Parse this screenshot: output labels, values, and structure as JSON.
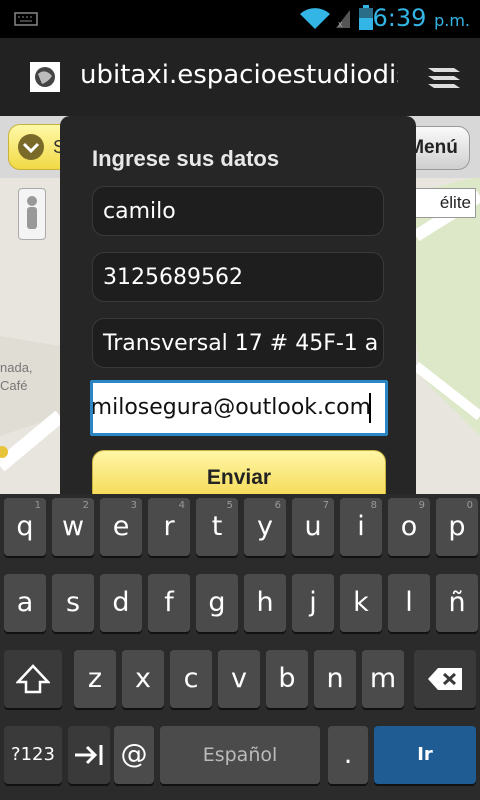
{
  "status_bar": {
    "time": "6:39",
    "ampm": "p.m."
  },
  "browser": {
    "url": "ubitaxi.espacioestudiodise"
  },
  "page": {
    "menu_label": "Menú",
    "map_type_label": "élite",
    "map_text_1": "nada,",
    "map_text_2": "Café",
    "partial_text": "S"
  },
  "dialog": {
    "title": "Ingrese sus datos",
    "name_value": "camilo",
    "phone_value": "3125689562",
    "address_value": "Transversal 17 # 45F-1 a",
    "email_value": "camilosegura@outlook.com",
    "submit_label": "Enviar"
  },
  "keyboard": {
    "row1": [
      {
        "k": "q",
        "h": "1"
      },
      {
        "k": "w",
        "h": "2"
      },
      {
        "k": "e",
        "h": "3"
      },
      {
        "k": "r",
        "h": "4"
      },
      {
        "k": "t",
        "h": "5"
      },
      {
        "k": "y",
        "h": "6"
      },
      {
        "k": "u",
        "h": "7"
      },
      {
        "k": "i",
        "h": "8"
      },
      {
        "k": "o",
        "h": "9"
      },
      {
        "k": "p",
        "h": "0"
      }
    ],
    "row2": [
      "a",
      "s",
      "d",
      "f",
      "g",
      "h",
      "j",
      "k",
      "l",
      "ñ"
    ],
    "row3": [
      "z",
      "x",
      "c",
      "v",
      "b",
      "n",
      "m"
    ],
    "symbols_label": "?123",
    "at_label": "@",
    "space_label": "Español",
    "period_label": ".",
    "go_label": "Ir"
  }
}
